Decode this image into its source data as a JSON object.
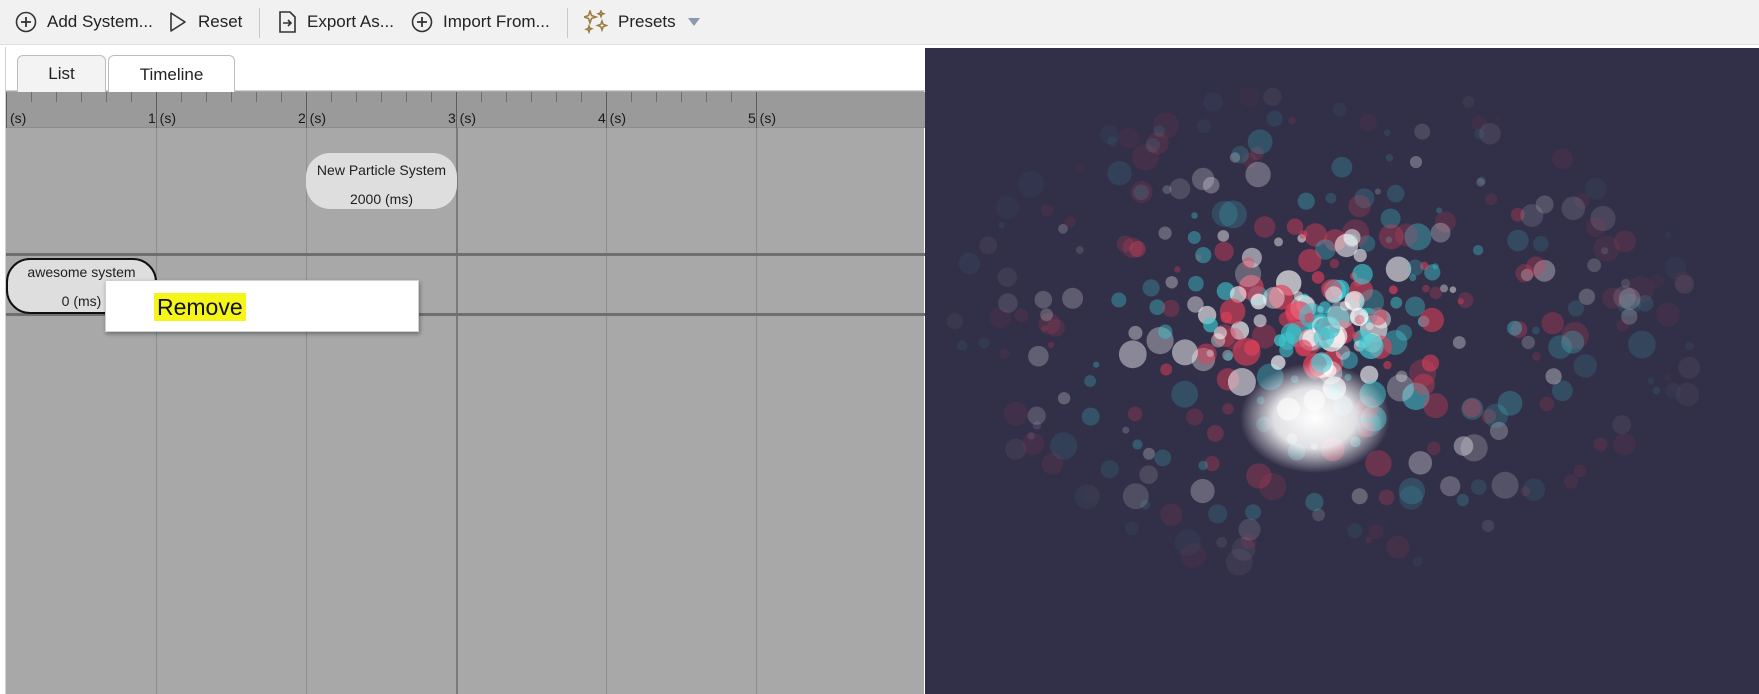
{
  "toolbar": {
    "add_system": "Add System...",
    "reset": "Reset",
    "export_as": "Export As...",
    "import_from": "Import From...",
    "presets": "Presets"
  },
  "tabs": {
    "list": "List",
    "timeline": "Timeline",
    "active": "timeline"
  },
  "ruler": {
    "labels": [
      "(s)",
      "1 (s)",
      "2 (s)",
      "3 (s)",
      "4 (s)",
      "5 (s)"
    ]
  },
  "systems": [
    {
      "name": "New Particle System",
      "time": "2000 (ms)"
    },
    {
      "name": "awesome system",
      "time": "0 (ms)"
    }
  ],
  "context_menu": {
    "remove": "Remove"
  },
  "preview": {
    "background": "#322f48",
    "particle_colors": [
      "#e0405a",
      "#3ec8d0",
      "#ffffff"
    ]
  }
}
